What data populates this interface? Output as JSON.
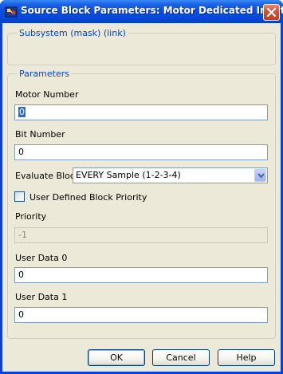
{
  "window": {
    "title": "Source Block Parameters: Motor Dedicated Input",
    "close_icon": "close-icon",
    "app_icon": "simulink-icon"
  },
  "subsystem_group": {
    "legend": "Subsystem (mask) (link)"
  },
  "parameters_group": {
    "legend": "Parameters",
    "motor_number": {
      "label": "Motor Number",
      "value": "0"
    },
    "bit_number": {
      "label": "Bit Number",
      "value": "0"
    },
    "evaluate_block": {
      "label": "Evaluate Block",
      "selected": "EVERY Sample (1-2-3-4)"
    },
    "user_defined_priority": {
      "label": "User Defined Block Priority",
      "checked": false
    },
    "priority": {
      "label": "Priority",
      "value": "-1"
    },
    "user_data_0": {
      "label": "User Data 0",
      "value": "0"
    },
    "user_data_1": {
      "label": "User Data 1",
      "value": "0"
    }
  },
  "buttons": {
    "ok": "OK",
    "cancel": "Cancel",
    "help": "Help"
  },
  "colors": {
    "titlebar": "#0a4ee0",
    "legend_text": "#0046d5",
    "dialog_bg": "#ece9d8",
    "close_button": "#d5502e"
  }
}
